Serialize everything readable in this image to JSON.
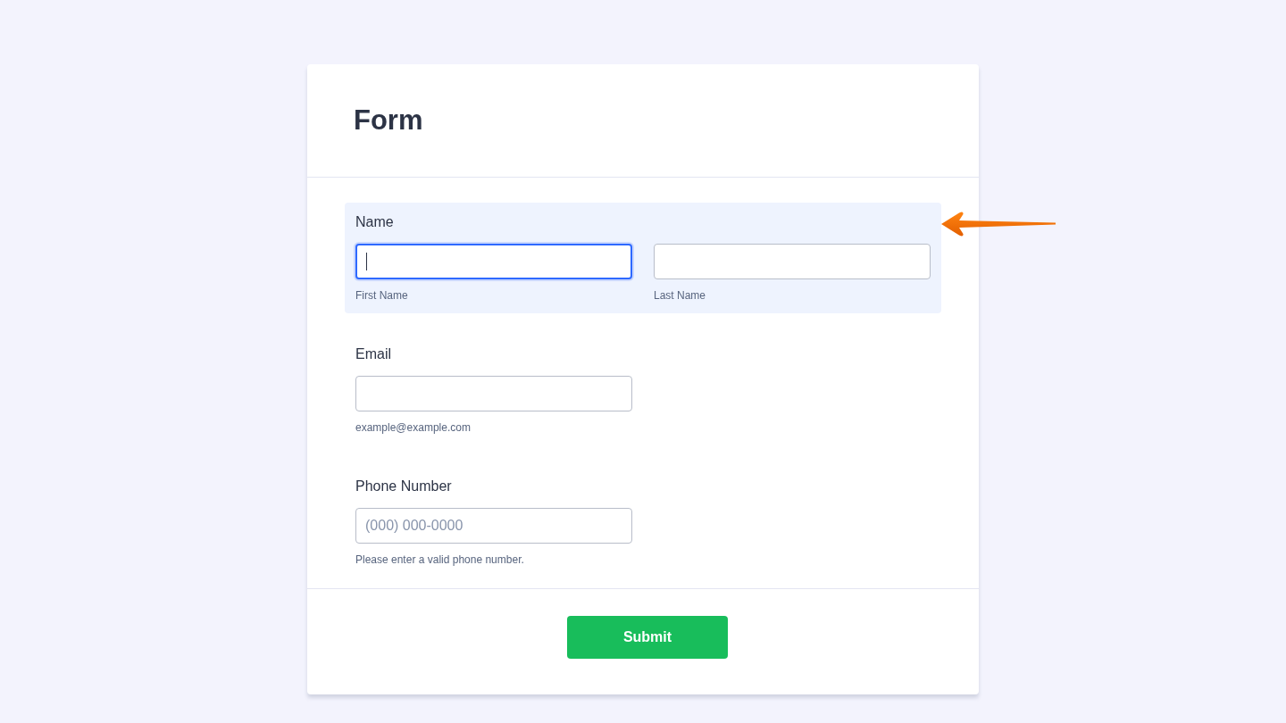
{
  "form": {
    "title": "Form",
    "fields": [
      {
        "kind": "name",
        "label": "Name",
        "highlighted": true,
        "inputs": [
          {
            "sublabel": "First Name",
            "focused": true
          },
          {
            "sublabel": "Last Name",
            "focused": false
          }
        ]
      },
      {
        "kind": "single",
        "label": "Email",
        "highlighted": false,
        "inputs": [
          {
            "sublabel": "example@example.com",
            "focused": false
          }
        ]
      },
      {
        "kind": "single",
        "label": "Phone Number",
        "highlighted": false,
        "inputs": [
          {
            "placeholder": "(000) 000-0000",
            "sublabel": "Please enter a valid phone number.",
            "focused": false
          }
        ]
      }
    ],
    "submit_button": "Submit"
  }
}
